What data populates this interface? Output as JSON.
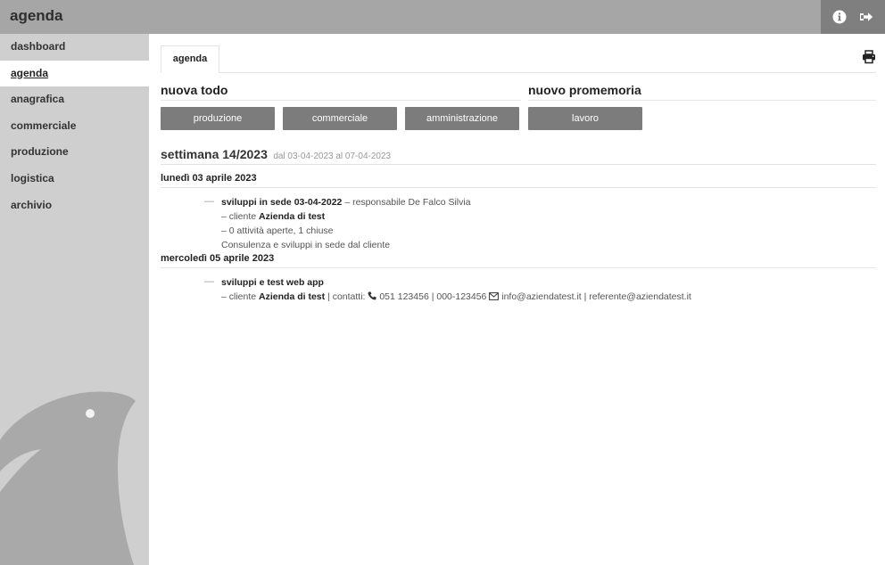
{
  "app": {
    "title": "agenda"
  },
  "topbar": {
    "info_icon": "info-circle-icon",
    "logout_icon": "sign-out-icon"
  },
  "sidebar": {
    "items": [
      {
        "label": "dashboard"
      },
      {
        "label": "agenda"
      },
      {
        "label": "anagrafica"
      },
      {
        "label": "commerciale"
      },
      {
        "label": "produzione"
      },
      {
        "label": "logistica"
      },
      {
        "label": "archivio"
      }
    ]
  },
  "main": {
    "tab": "agenda",
    "todo_title": "nuova todo",
    "promemoria_title": "nuovo promemoria",
    "buttons": {
      "produzione": "produzione",
      "commerciale": "commerciale",
      "amministrazione": "amministrazione",
      "lavoro": "lavoro"
    },
    "week": {
      "title": "settimana 14/2023",
      "range": "dal 03-04-2023 al 07-04-2023"
    },
    "days": [
      {
        "label": "lunedì 03 aprile 2023",
        "event": {
          "dash": "—",
          "title": "sviluppi in sede 03-04-2022",
          "responsible": "– responsabile De Falco Silvia",
          "client_prefix": "– cliente ",
          "client": "Azienda di test",
          "activities": "– 0 attività aperte, 1 chiuse",
          "description": "Consulenza e sviluppi in sede dal cliente"
        }
      },
      {
        "label": "mercoledì 05 aprile 2023",
        "event": {
          "dash": "—",
          "title": "sviluppi e test web app",
          "client_prefix": "– cliente ",
          "client": "Azienda di test",
          "contacts_prefix": " | contatti: ",
          "phones": "051 123456 | 000-123456",
          "email1": "info@aziendatest.it",
          "email2": "referente@aziendatest.it",
          "separator": " | "
        }
      }
    ]
  }
}
